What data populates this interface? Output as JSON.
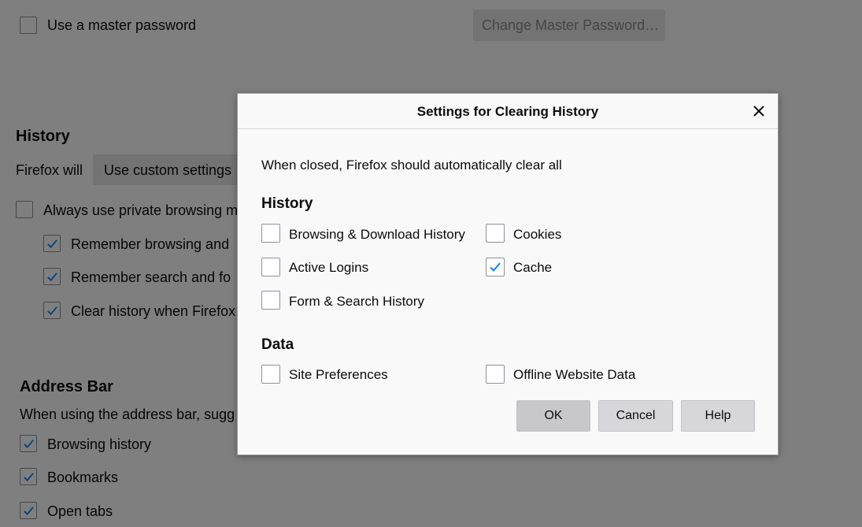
{
  "background": {
    "master_password": {
      "label": "Use a master password",
      "checked": false
    },
    "change_master_button": "Change Master Password…",
    "history_heading": "History",
    "firefox_will_label": "Firefox will",
    "history_mode_value": "Use custom settings",
    "always_private": {
      "label": "Always use private browsing m",
      "checked": false
    },
    "remember_browsing": {
      "label": "Remember browsing and",
      "checked": true
    },
    "remember_search": {
      "label": "Remember search and fo",
      "checked": true
    },
    "clear_history": {
      "label": "Clear history when Firefox",
      "checked": true
    },
    "address_bar_heading": "Address Bar",
    "address_bar_desc": "When using the address bar, sugg",
    "browsing_history": {
      "label": "Browsing history",
      "checked": true
    },
    "bookmarks": {
      "label": "Bookmarks",
      "checked": true
    },
    "open_tabs": {
      "label": "Open tabs",
      "checked": true
    }
  },
  "dialog": {
    "title": "Settings for Clearing History",
    "intro": "When closed, Firefox should automatically clear all",
    "history_heading": "History",
    "data_heading": "Data",
    "history_items": [
      {
        "label": "Browsing & Download History",
        "checked": false
      },
      {
        "label": "Cookies",
        "checked": false
      },
      {
        "label": "Active Logins",
        "checked": false
      },
      {
        "label": "Cache",
        "checked": true
      },
      {
        "label": "Form & Search History",
        "checked": false
      }
    ],
    "data_items": [
      {
        "label": "Site Preferences",
        "checked": false
      },
      {
        "label": "Offline Website Data",
        "checked": false
      }
    ],
    "buttons": {
      "ok": "OK",
      "cancel": "Cancel",
      "help": "Help"
    }
  },
  "colors": {
    "accent": "#0a84ff",
    "overlay": "rgba(0,0,0,0.5)",
    "dialog_bg": "#f9f9fa"
  },
  "icons": {
    "check": "check-icon",
    "close": "close-icon"
  }
}
